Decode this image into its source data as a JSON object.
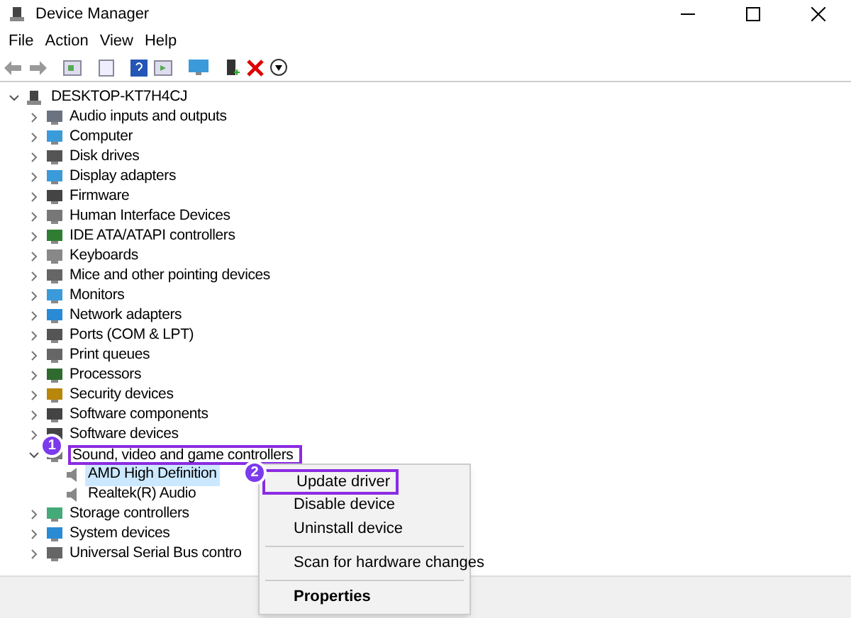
{
  "window": {
    "title": "Device Manager"
  },
  "menu": [
    "File",
    "Action",
    "View",
    "Help"
  ],
  "tree": {
    "label": "DESKTOP-KT7H4CJ",
    "expanded": true,
    "children": [
      {
        "label": "Audio inputs and outputs",
        "expanded": false
      },
      {
        "label": "Computer",
        "expanded": false
      },
      {
        "label": "Disk drives",
        "expanded": false
      },
      {
        "label": "Display adapters",
        "expanded": false
      },
      {
        "label": "Firmware",
        "expanded": false
      },
      {
        "label": "Human Interface Devices",
        "expanded": false
      },
      {
        "label": "IDE ATA/ATAPI controllers",
        "expanded": false
      },
      {
        "label": "Keyboards",
        "expanded": false
      },
      {
        "label": "Mice and other pointing devices",
        "expanded": false
      },
      {
        "label": "Monitors",
        "expanded": false
      },
      {
        "label": "Network adapters",
        "expanded": false
      },
      {
        "label": "Ports (COM & LPT)",
        "expanded": false
      },
      {
        "label": "Print queues",
        "expanded": false
      },
      {
        "label": "Processors",
        "expanded": false
      },
      {
        "label": "Security devices",
        "expanded": false
      },
      {
        "label": "Software components",
        "expanded": false
      },
      {
        "label": "Software devices",
        "expanded": false
      },
      {
        "label": "Sound, video and game controllers",
        "expanded": true,
        "callout": "1",
        "children": [
          {
            "label": "AMD High Definition",
            "selected": true
          },
          {
            "label": "Realtek(R) Audio",
            "selected": false
          }
        ]
      },
      {
        "label": "Storage controllers",
        "expanded": false
      },
      {
        "label": "System devices",
        "expanded": false
      },
      {
        "label": "Universal Serial Bus contro",
        "expanded": false
      }
    ]
  },
  "context_menu": [
    {
      "kind": "item",
      "label": "Update driver",
      "callout": "2"
    },
    {
      "kind": "item",
      "label": "Disable device"
    },
    {
      "kind": "item",
      "label": "Uninstall device"
    },
    {
      "kind": "separator"
    },
    {
      "kind": "item",
      "label": "Scan for hardware changes"
    },
    {
      "kind": "separator"
    },
    {
      "kind": "bold",
      "label": "Properties"
    }
  ]
}
